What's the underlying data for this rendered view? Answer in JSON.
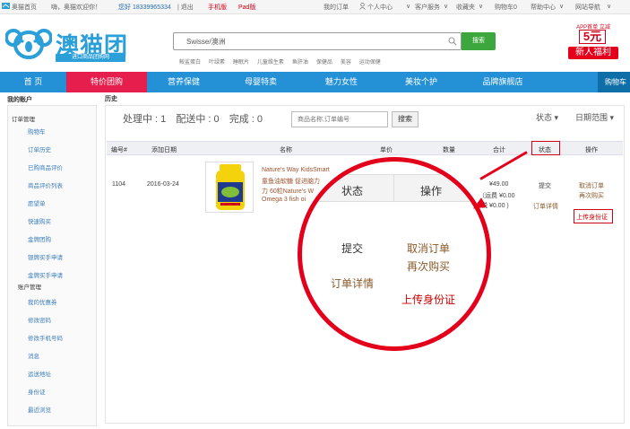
{
  "topbar": {
    "home": "奥猫首页",
    "welcome": "嗨，奥猫欢迎你！",
    "user": "您好 18339965334",
    "logout": "| 退出",
    "mobile": "手机版",
    "pad": "Pad版",
    "my_orders": "我的订单",
    "personal_center": "个人中心",
    "customer_service": "客户服务",
    "favorites": "收藏夹",
    "cart": "购物车0",
    "help_center": "帮助中心",
    "site_nav": "网站导航"
  },
  "header": {
    "logo_text": "澳猫团",
    "logo_sub": "进口商品团购网",
    "search_placeholder": "Swisse/澳洲",
    "search_button": "搜索",
    "hotwords": [
      "鲛鲨蛋白",
      "叶绿素",
      "睡眠片",
      "儿童维生素",
      "鱼肝油",
      "保健品",
      "美容",
      "运动保健"
    ],
    "promo": {
      "top": "APP首单 立减",
      "amount": "5元",
      "bottom": "新人福利"
    }
  },
  "nav": {
    "items": [
      "首 页",
      "特价团购",
      "营养保健",
      "母婴特卖",
      "魅力女性",
      "美妆个护",
      "品牌旗舰店"
    ],
    "cart": "购物车"
  },
  "sidebar": {
    "title": "我的账户",
    "section_orders": "订单管理",
    "order_items": [
      "购物车",
      "订单历史",
      "已购商品评价",
      "商品评价列表",
      "愿望单",
      "快速购买",
      "金牌团购",
      "银牌买手申请",
      "金牌买手申请"
    ],
    "section_account": "账户管理",
    "account_items": [
      "我的优惠券",
      "修改密码",
      "修改手机号码",
      "消息",
      "运送地址",
      "身份证",
      "最近浏览"
    ]
  },
  "main": {
    "title": "历史",
    "processing": "处理中 : 1",
    "shipping": "配送中 : 0",
    "completed": "完成 : 0",
    "order_search_placeholder": "商品名称,订单编号",
    "search_button": "搜索",
    "status_filter": "状态",
    "date_filter": "日期范围"
  },
  "table": {
    "headers": {
      "id": "编号#",
      "date": "添加日期",
      "name": "名称",
      "price": "单价",
      "qty": "数量",
      "total": "合计",
      "status": "状态",
      "actions": "操作"
    },
    "row": {
      "id": "1104",
      "date": "2016-03-24",
      "name_lines": [
        "Nature's Way KidsSmart",
        "童鱼油软糖 促进脑力",
        "力 60粒Nature's W",
        "Omega 3 fish oi"
      ],
      "price": "¥49.00",
      "shipping": "（运费 ¥0.00",
      "tax": "税 ¥0.00 )",
      "status": "提交",
      "detail": "订单详情",
      "cancel": "取消订单",
      "rebuy": "再次购买",
      "upload_id": "上传身份证"
    }
  },
  "magnifier": {
    "status_header": "状态",
    "actions_header": "操作",
    "status": "提交",
    "cancel": "取消订单",
    "rebuy": "再次购买",
    "detail": "订单详情",
    "upload_id": "上传身份证"
  },
  "colors": {
    "nav_blue": "#2490d6",
    "nav_active": "#e61e4d",
    "accent_red": "#e3001b",
    "link_blue": "#3a7dbd",
    "search_green": "#3ca73c"
  }
}
